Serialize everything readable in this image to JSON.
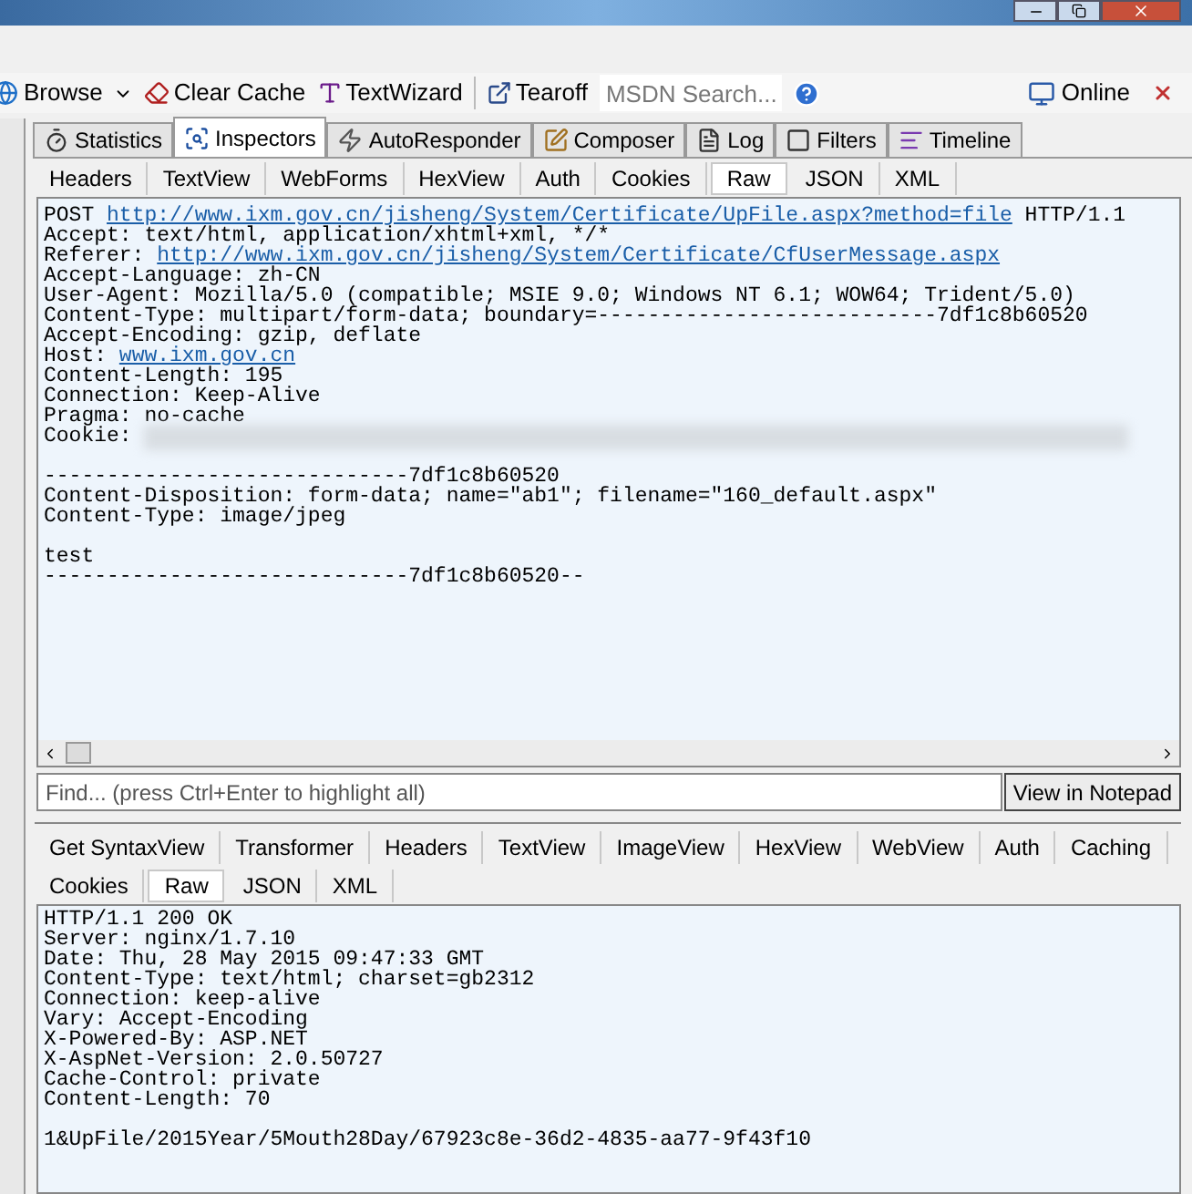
{
  "toolbar": {
    "items": [
      {
        "kind": "dropdown",
        "label": "Browse"
      },
      {
        "kind": "button",
        "label": "Clear Cache"
      },
      {
        "kind": "button",
        "label": "TextWizard"
      },
      {
        "kind": "separator"
      },
      {
        "kind": "button",
        "label": "Tearoff"
      },
      {
        "kind": "search",
        "placeholder": "MSDN Search..."
      },
      {
        "kind": "help"
      }
    ],
    "online": "Online"
  },
  "tabs": [
    {
      "label": "Statistics",
      "selected": false
    },
    {
      "label": "Inspectors",
      "selected": true
    },
    {
      "label": "AutoResponder",
      "selected": false
    },
    {
      "label": "Composer",
      "selected": false
    },
    {
      "label": "Log",
      "selected": false
    },
    {
      "label": "Filters",
      "selected": false
    },
    {
      "label": "Timeline",
      "selected": false
    }
  ],
  "request": {
    "tabs": [
      {
        "label": "Headers",
        "selected": false
      },
      {
        "label": "TextView",
        "selected": false
      },
      {
        "label": "WebForms",
        "selected": false
      },
      {
        "label": "HexView",
        "selected": false
      },
      {
        "label": "Auth",
        "selected": false
      },
      {
        "label": "Cookies",
        "selected": false
      },
      {
        "label": "Raw",
        "selected": true
      },
      {
        "label": "JSON",
        "selected": false
      },
      {
        "label": "XML",
        "selected": false
      }
    ],
    "sections": [
      [
        [
          {
            "kind": "text",
            "text": "POST "
          },
          {
            "kind": "link",
            "text": "http://www.ixm.gov.cn/jisheng/System/Certificate/UpFile.aspx?method=file"
          },
          {
            "kind": "text",
            "text": " HTTP/1.1"
          }
        ],
        [
          {
            "kind": "text",
            "text": "Accept: text/html, application/xhtml+xml, */*"
          }
        ],
        [
          {
            "kind": "text",
            "text": "Referer: "
          },
          {
            "kind": "link",
            "text": "http://www.ixm.gov.cn/jisheng/System/Certificate/CfUserMessage.aspx"
          }
        ],
        [
          {
            "kind": "text",
            "text": "Accept-Language: zh-CN"
          }
        ],
        [
          {
            "kind": "text",
            "text": "User-Agent: Mozilla/5.0 (compatible; MSIE 9.0; Windows NT 6.1; WOW64; Trident/5.0)"
          }
        ],
        [
          {
            "kind": "text",
            "text": "Content-Type: multipart/form-data; boundary=---------------------------7df1c8b60520"
          }
        ],
        [
          {
            "kind": "text",
            "text": "Accept-Encoding: gzip, deflate"
          }
        ],
        [
          {
            "kind": "text",
            "text": "Host: "
          },
          {
            "kind": "link",
            "text": "www.ixm.gov.cn"
          }
        ],
        [
          {
            "kind": "text",
            "text": "Content-Length: 195"
          }
        ],
        [
          {
            "kind": "text",
            "text": "Connection: Keep-Alive"
          }
        ],
        [
          {
            "kind": "text",
            "text": "Pragma: no-cache"
          }
        ],
        [
          {
            "kind": "text",
            "text": "Cookie: "
          },
          {
            "kind": "blur"
          }
        ]
      ],
      [
        [
          {
            "kind": "text",
            "text": "-----------------------------7df1c8b60520"
          }
        ],
        [
          {
            "kind": "text",
            "text": "Content-Disposition: form-data; name=\"ab1\"; filename=\"160_default.aspx\""
          }
        ],
        [
          {
            "kind": "text",
            "text": "Content-Type: image/jpeg"
          }
        ]
      ],
      [
        [
          {
            "kind": "text",
            "text": "test"
          }
        ],
        [
          {
            "kind": "text",
            "text": "-----------------------------7df1c8b60520--"
          }
        ]
      ]
    ],
    "find_placeholder": "Find... (press Ctrl+Enter to highlight all)",
    "notepad_button": "View in Notepad"
  },
  "response": {
    "tab_rows": [
      [
        {
          "label": "Get SyntaxView",
          "selected": false
        },
        {
          "label": "Transformer",
          "selected": false
        },
        {
          "label": "Headers",
          "selected": false
        },
        {
          "label": "TextView",
          "selected": false
        },
        {
          "label": "ImageView",
          "selected": false
        },
        {
          "label": "HexView",
          "selected": false
        },
        {
          "label": "WebView",
          "selected": false
        },
        {
          "label": "Auth",
          "selected": false
        },
        {
          "label": "Caching",
          "selected": false
        }
      ],
      [
        {
          "label": "Cookies",
          "selected": false
        },
        {
          "label": "Raw",
          "selected": true
        },
        {
          "label": "JSON",
          "selected": false
        },
        {
          "label": "XML",
          "selected": false
        }
      ]
    ],
    "sections": [
      [
        [
          {
            "kind": "text",
            "text": "HTTP/1.1 200 OK"
          }
        ],
        [
          {
            "kind": "text",
            "text": "Server: nginx/1.7.10"
          }
        ],
        [
          {
            "kind": "text",
            "text": "Date: Thu, 28 May 2015 09:47:33 GMT"
          }
        ],
        [
          {
            "kind": "text",
            "text": "Content-Type: text/html; charset=gb2312"
          }
        ],
        [
          {
            "kind": "text",
            "text": "Connection: keep-alive"
          }
        ],
        [
          {
            "kind": "text",
            "text": "Vary: Accept-Encoding"
          }
        ],
        [
          {
            "kind": "text",
            "text": "X-Powered-By: ASP.NET"
          }
        ],
        [
          {
            "kind": "text",
            "text": "X-AspNet-Version: 2.0.50727"
          }
        ],
        [
          {
            "kind": "text",
            "text": "Cache-Control: private"
          }
        ],
        [
          {
            "kind": "text",
            "text": "Content-Length: 70"
          }
        ]
      ],
      [
        [
          {
            "kind": "text",
            "text": "1&UpFile/2015Year/5Mouth28Day/67923c8e-36d2-4835-aa77-9f43f10"
          }
        ]
      ]
    ]
  }
}
